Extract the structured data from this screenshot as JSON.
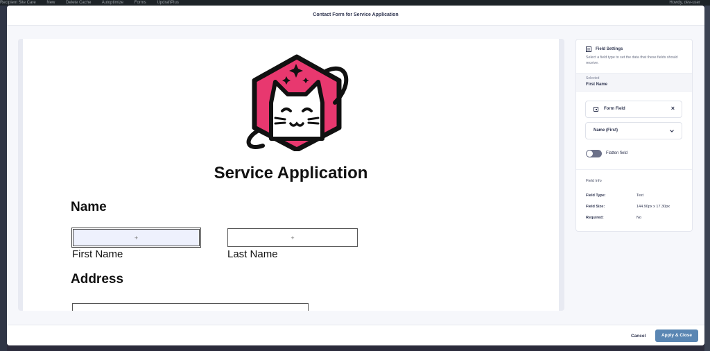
{
  "admin_bar": {
    "items": [
      "Recipient Site Care",
      "New",
      "Delete Cache",
      "Autoptimize",
      "Forms",
      "UpdraftPlus",
      "Howdy, dev-user"
    ]
  },
  "modal": {
    "title": "Contact Form for Service Application"
  },
  "form": {
    "title": "Service Application",
    "sections": {
      "name_heading": "Name",
      "address_heading": "Address"
    },
    "first_name": {
      "label": "First Name",
      "placeholder_icon": "+"
    },
    "last_name": {
      "label": "Last Name",
      "placeholder_icon": "+"
    }
  },
  "sidebar": {
    "heading": "Field Settings",
    "description": "Select a field type to set the data that these fields should receive.",
    "selected_caption": "Selected",
    "selected_value": "First Name",
    "form_field_label": "Form Field",
    "close_symbol": "×",
    "dropdown_value": "Name (First)",
    "flatten_label": "Flatten field",
    "flatten_on": false,
    "field_info": {
      "heading": "Field Info",
      "rows": [
        {
          "key": "Field Type:",
          "value": "Text"
        },
        {
          "key": "Field Size:",
          "value": "144.90px x 17.30px"
        },
        {
          "key": "Required:",
          "value": "No"
        }
      ]
    }
  },
  "footer": {
    "cancel_label": "Cancel",
    "apply_label": "Apply & Close"
  },
  "colors": {
    "accent": "#5a86b3",
    "logo_pink": "#e8386f",
    "text_dark": "#2f3550"
  }
}
